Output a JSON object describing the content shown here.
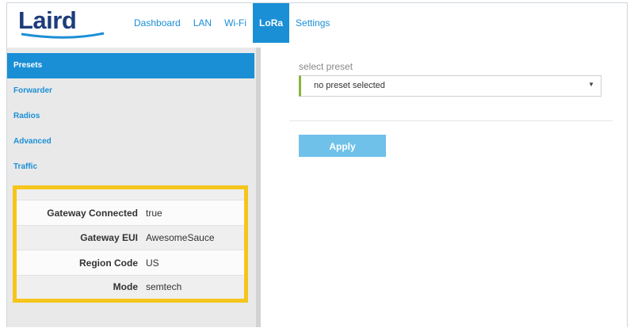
{
  "brand": {
    "logo_text": "Laird",
    "logo_color": "#1d3c7a"
  },
  "nav": {
    "items": [
      {
        "label": "Dashboard",
        "active": false
      },
      {
        "label": "LAN",
        "active": false
      },
      {
        "label": "Wi-Fi",
        "active": false
      },
      {
        "label": "LoRa",
        "active": true
      },
      {
        "label": "Settings",
        "active": false
      }
    ]
  },
  "sidebar": {
    "menu": [
      {
        "label": "Presets",
        "active": true
      },
      {
        "label": "Forwarder",
        "active": false
      },
      {
        "label": "Radios",
        "active": false
      },
      {
        "label": "Advanced",
        "active": false
      },
      {
        "label": "Traffic",
        "active": false
      }
    ],
    "status": [
      {
        "key": "Gateway Connected",
        "value": "true"
      },
      {
        "key": "Gateway EUI",
        "value": "AwesomeSauce"
      },
      {
        "key": "Region Code",
        "value": "US"
      },
      {
        "key": "Mode",
        "value": "semtech"
      }
    ]
  },
  "main": {
    "preset_label": "select preset",
    "preset_select": {
      "value": "no preset selected"
    },
    "apply_label": "Apply"
  },
  "colors": {
    "accent": "#1a8fd6",
    "highlight_border": "#f5c51c",
    "apply_button": "#6fc1ea",
    "select_left_bar": "#8ab53a"
  }
}
